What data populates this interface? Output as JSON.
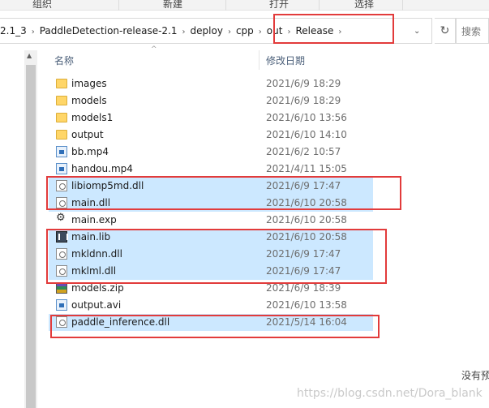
{
  "ribbon": {
    "organize": "组织",
    "new": "新建",
    "open": "打开",
    "select": "选择"
  },
  "address": {
    "crumbs": [
      "2.1_3",
      "PaddleDetection-release-2.1",
      "deploy",
      "cpp",
      "out",
      "Release"
    ],
    "search_placeholder": "搜索"
  },
  "columns": {
    "name": "名称",
    "date_modified": "修改日期"
  },
  "files": [
    {
      "name": "images",
      "date": "2021/6/9 18:29",
      "icon": "folder-icon",
      "selected": false
    },
    {
      "name": "models",
      "date": "2021/6/9 18:29",
      "icon": "folder-icon",
      "selected": false
    },
    {
      "name": "models1",
      "date": "2021/6/10 13:56",
      "icon": "folder-icon",
      "selected": false
    },
    {
      "name": "output",
      "date": "2021/6/10 14:10",
      "icon": "folder-icon",
      "selected": false
    },
    {
      "name": "bb.mp4",
      "date": "2021/6/2 10:57",
      "icon": "video-file-icon",
      "selected": false
    },
    {
      "name": "handou.mp4",
      "date": "2021/4/11 15:05",
      "icon": "video-file-icon",
      "selected": false
    },
    {
      "name": "libiomp5md.dll",
      "date": "2021/6/9 17:47",
      "icon": "dll-file-icon",
      "selected": true
    },
    {
      "name": "main.dll",
      "date": "2021/6/10 20:58",
      "icon": "dll-file-icon",
      "selected": true
    },
    {
      "name": "main.exp",
      "date": "2021/6/10 20:58",
      "icon": "exp-file-icon",
      "selected": false
    },
    {
      "name": "main.lib",
      "date": "2021/6/10 20:58",
      "icon": "lib-file-icon",
      "selected": true
    },
    {
      "name": "mkldnn.dll",
      "date": "2021/6/9 17:47",
      "icon": "dll-file-icon",
      "selected": true
    },
    {
      "name": "mklml.dll",
      "date": "2021/6/9 17:47",
      "icon": "dll-file-icon",
      "selected": true
    },
    {
      "name": "models.zip",
      "date": "2021/6/9 18:39",
      "icon": "zip-file-icon",
      "selected": false
    },
    {
      "name": "output.avi",
      "date": "2021/6/10 13:58",
      "icon": "video-file-icon",
      "selected": false
    },
    {
      "name": "paddle_inference.dll",
      "date": "2021/5/14 16:04",
      "icon": "dll-file-icon",
      "selected": true
    }
  ],
  "preview_message": "没有预",
  "watermark": "https://blog.csdn.net/Dora_blank",
  "colors": {
    "selection": "#cce8ff",
    "annotation_box": "#e23b3b",
    "folder": "#ffd668"
  }
}
